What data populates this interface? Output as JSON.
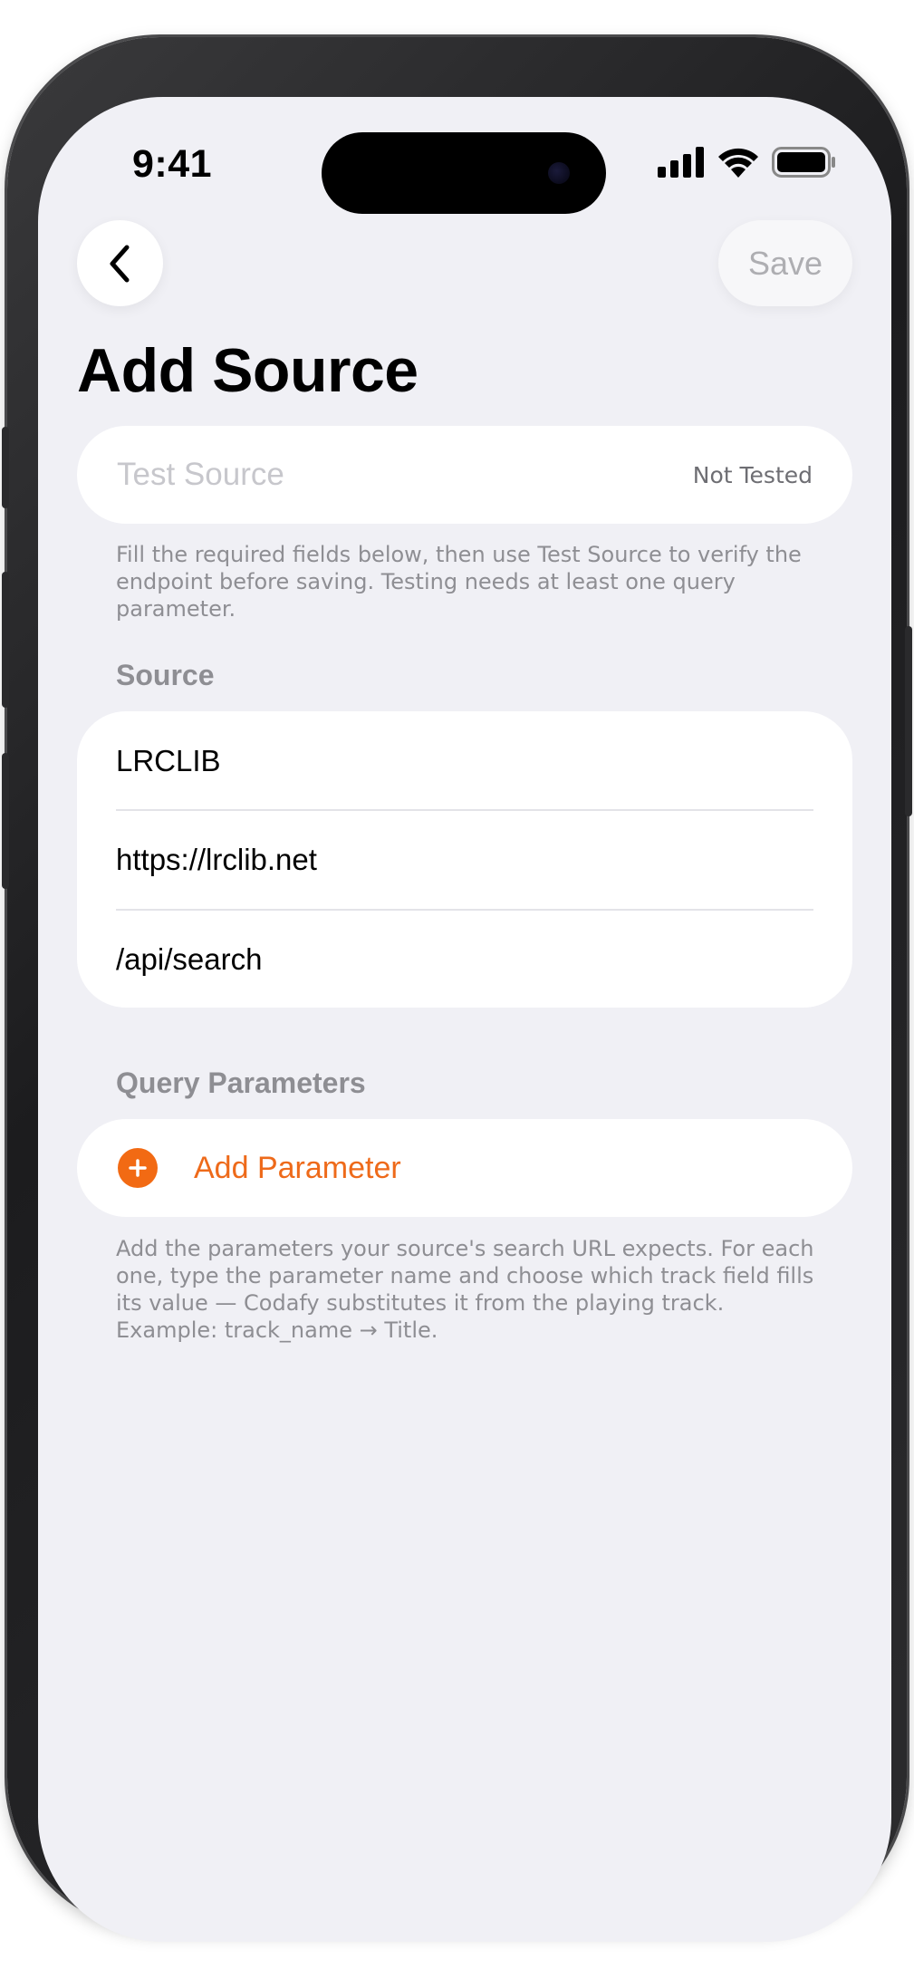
{
  "status_bar": {
    "time": "9:41",
    "icons": [
      "cellular-signal-icon",
      "wifi-icon",
      "battery-icon"
    ]
  },
  "nav": {
    "back_icon": "chevron-left-icon",
    "save_label": "Save"
  },
  "page": {
    "title": "Add Source"
  },
  "test_source": {
    "label": "Test Source",
    "status": "Not Tested",
    "footnote": "Fill the required fields below, then use Test Source to verify the endpoint before saving. Testing needs at least one query parameter."
  },
  "source_section": {
    "header": "Source",
    "fields": [
      {
        "value": "LRCLIB"
      },
      {
        "value": "https://lrclib.net"
      },
      {
        "value": "/api/search"
      }
    ]
  },
  "query_section": {
    "header": "Query Parameters",
    "add_label": "Add Parameter",
    "add_icon": "plus-circle-icon",
    "footnote": "Add the parameters your source's search URL expects. For each one, type the parameter name and choose which track field fills its value — Codafy substitutes it from the playing track. Example: track_name → Title."
  },
  "colors": {
    "accent": "#F26A13",
    "background": "#F0F0F5",
    "card": "#FFFFFF",
    "secondary_text": "#8E8E93",
    "disabled_text": "#AEAEB2"
  }
}
